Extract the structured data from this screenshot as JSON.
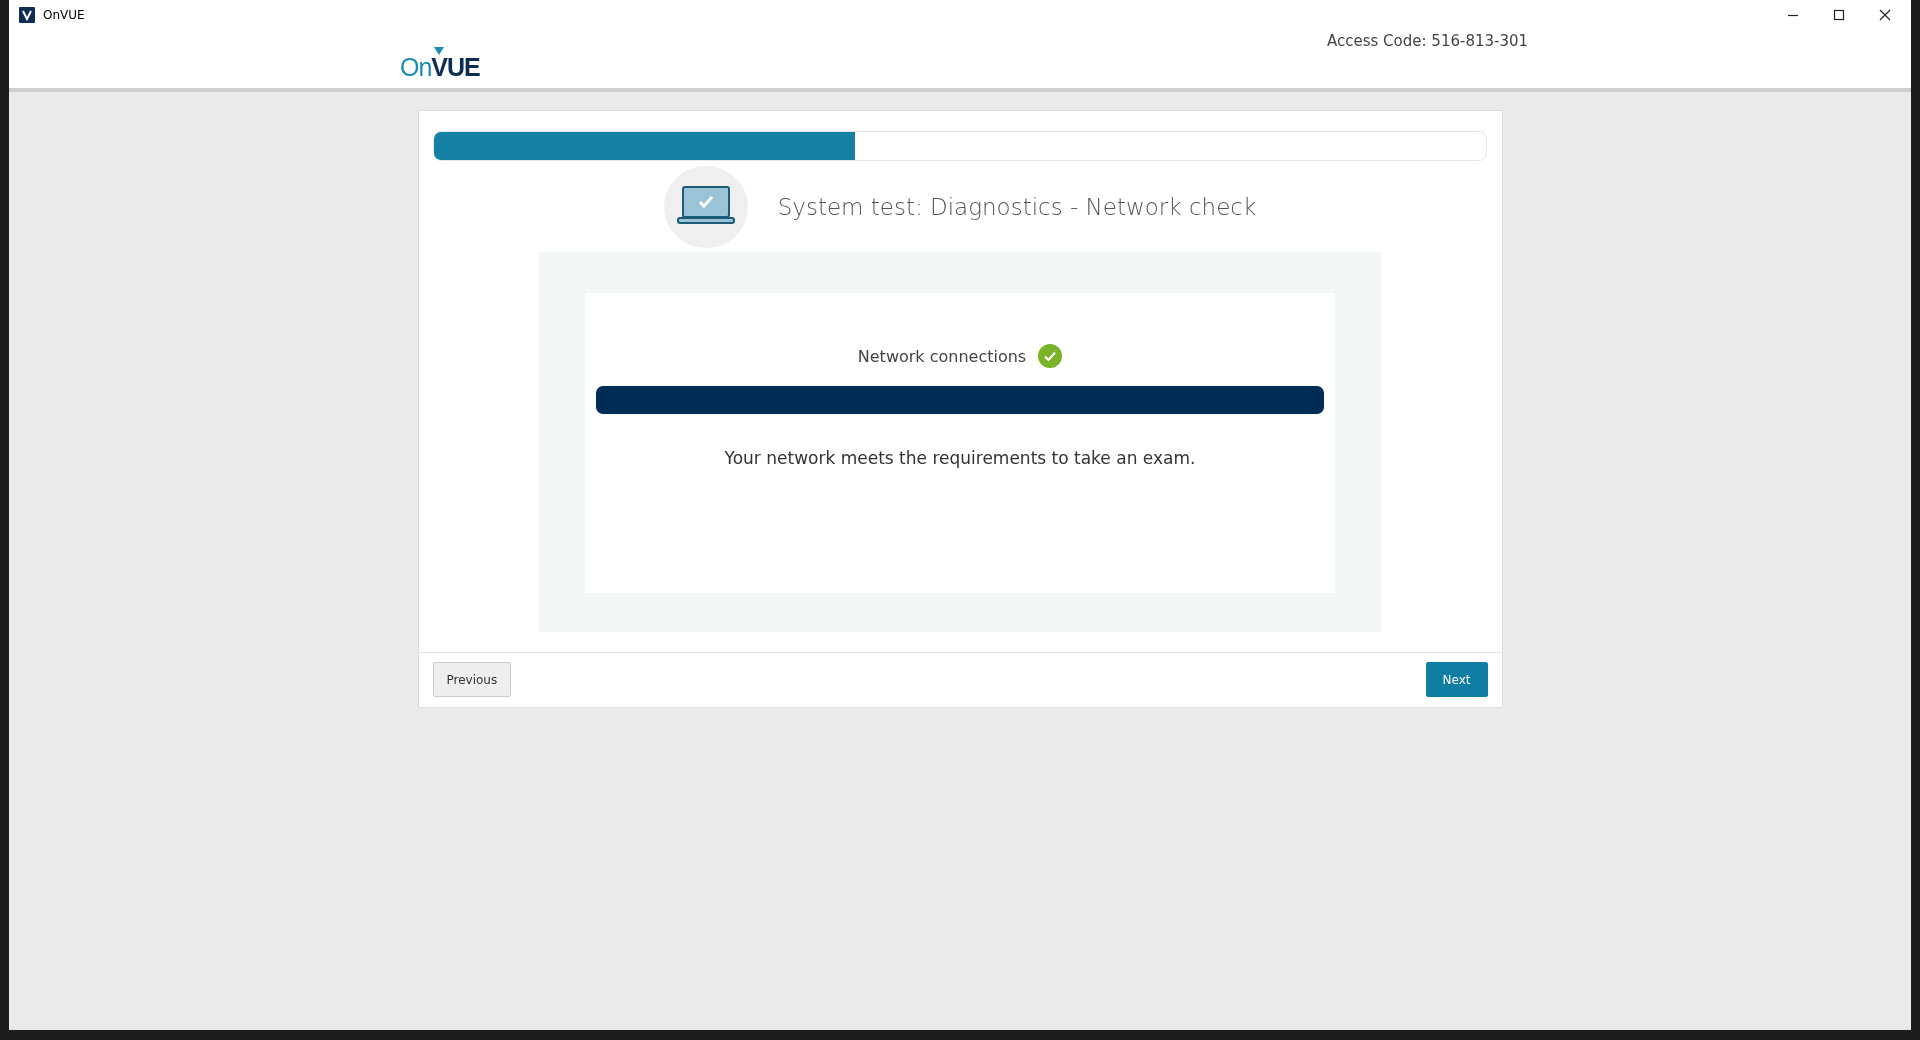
{
  "window": {
    "title": "OnVUE"
  },
  "header": {
    "logo": {
      "parts": [
        "On",
        "VUE"
      ]
    },
    "access_code": "Access Code: 516-813-301"
  },
  "progress": {
    "level": 0.4
  },
  "step": {
    "title": "System test: Diagnostics - Network check"
  },
  "check": {
    "label": "Network connections",
    "passed": true,
    "level": 1,
    "message": "Your network meets the requirements to take an exam."
  },
  "buttons": [
    {
      "label": "Previous",
      "kind": "secondary"
    },
    {
      "label": "Next",
      "kind": "primary"
    }
  ]
}
